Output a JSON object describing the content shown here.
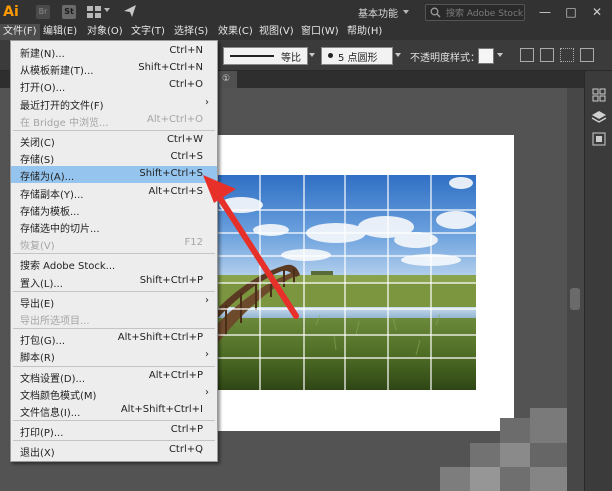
{
  "app": {
    "logo_text": "Ai",
    "bridge_label": "Br",
    "stock_label": "St",
    "workspace": "基本功能",
    "search_placeholder": "搜索 Adobe Stock",
    "window_buttons": [
      "—",
      "□",
      "✕"
    ]
  },
  "menubar": [
    {
      "label": "文件(F)",
      "active": true
    },
    {
      "label": "编辑(E)"
    },
    {
      "label": "对象(O)"
    },
    {
      "label": "文字(T)"
    },
    {
      "label": "选择(S)"
    },
    {
      "label": "效果(C)"
    },
    {
      "label": "视图(V)"
    },
    {
      "label": "窗口(W)"
    },
    {
      "label": "帮助(H)"
    }
  ],
  "control_bar": {
    "stroke_profile": "等比",
    "brush": "5 点圆形",
    "opacity_label": "不透明度",
    "style_label": "样式："
  },
  "tab_fragment": "①",
  "file_menu": [
    {
      "label": "新建(N)...",
      "shortcut": "Ctrl+N"
    },
    {
      "label": "从模板新建(T)...",
      "shortcut": "Shift+Ctrl+N"
    },
    {
      "label": "打开(O)...",
      "shortcut": "Ctrl+O"
    },
    {
      "label": "最近打开的文件(F)",
      "submenu": true
    },
    {
      "label": "在 Bridge 中浏览...",
      "shortcut": "Alt+Ctrl+O",
      "disabled": true
    },
    {
      "separator": true
    },
    {
      "label": "关闭(C)",
      "shortcut": "Ctrl+W"
    },
    {
      "label": "存储(S)",
      "shortcut": "Ctrl+S"
    },
    {
      "label": "存储为(A)...",
      "shortcut": "Shift+Ctrl+S",
      "highlighted": true
    },
    {
      "label": "存储副本(Y)...",
      "shortcut": "Alt+Ctrl+S"
    },
    {
      "label": "存储为模板..."
    },
    {
      "label": "存储选中的切片..."
    },
    {
      "label": "恢复(V)",
      "shortcut": "F12",
      "disabled": true
    },
    {
      "separator": true
    },
    {
      "label": "搜索 Adobe Stock..."
    },
    {
      "label": "置入(L)...",
      "shortcut": "Shift+Ctrl+P"
    },
    {
      "separator": true
    },
    {
      "label": "导出(E)",
      "submenu": true
    },
    {
      "label": "导出所选项目...",
      "disabled": true
    },
    {
      "separator": true
    },
    {
      "label": "打包(G)...",
      "shortcut": "Alt+Shift+Ctrl+P"
    },
    {
      "label": "脚本(R)",
      "submenu": true
    },
    {
      "separator": true
    },
    {
      "label": "文档设置(D)...",
      "shortcut": "Alt+Ctrl+P"
    },
    {
      "label": "文档颜色模式(M)",
      "submenu": true
    },
    {
      "label": "文件信息(I)...",
      "shortcut": "Alt+Shift+Ctrl+I"
    },
    {
      "separator": true
    },
    {
      "label": "打印(P)...",
      "shortcut": "Ctrl+P"
    },
    {
      "separator": true
    },
    {
      "label": "退出(X)",
      "shortcut": "Ctrl+Q"
    }
  ],
  "colors": {
    "menu_highlight": "#95c5ee",
    "annotation_arrow": "#e8302a",
    "logo": "#ff9a00"
  }
}
